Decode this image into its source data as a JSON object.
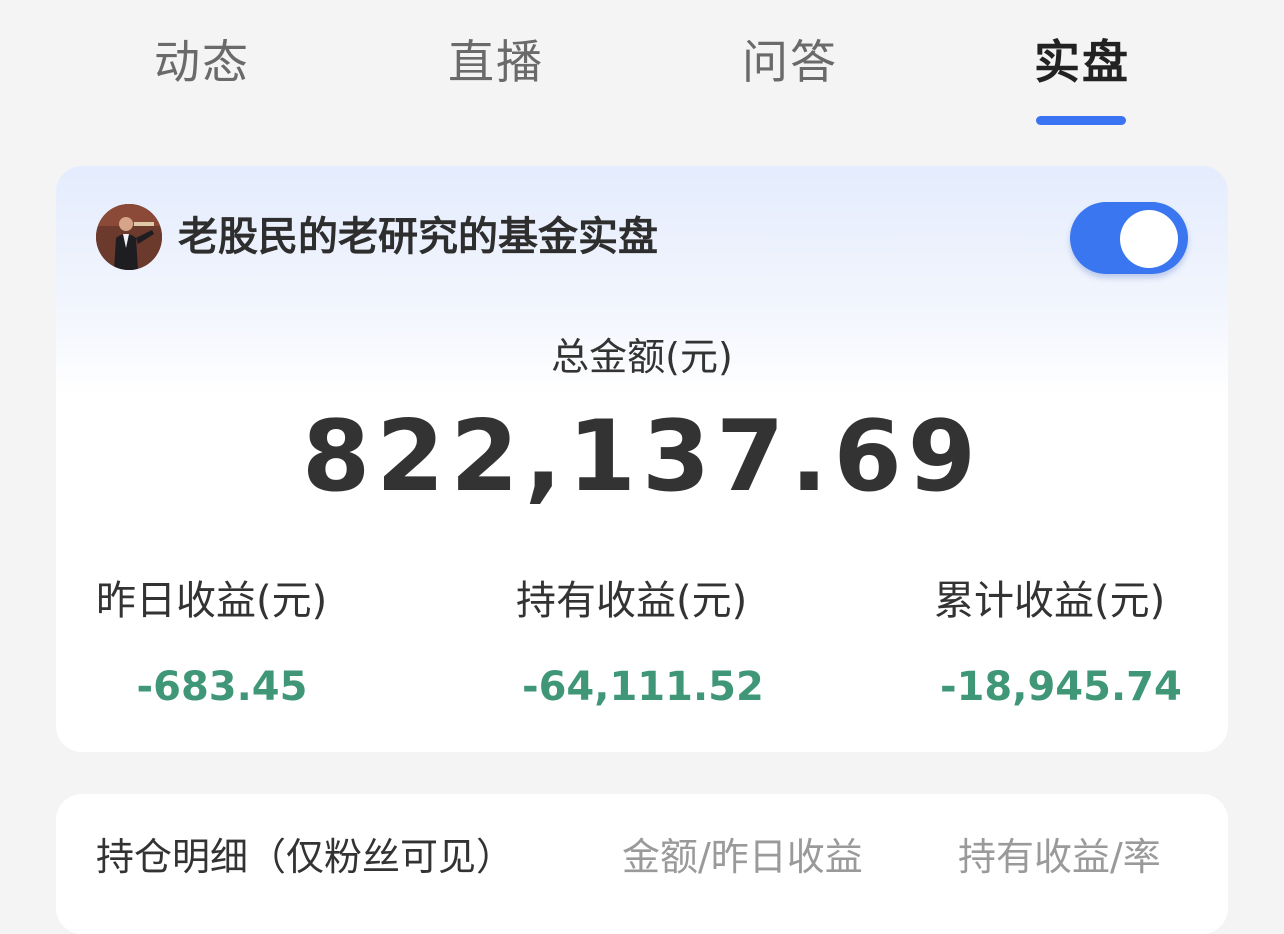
{
  "tabs": [
    {
      "label": "动态",
      "active": false
    },
    {
      "label": "直播",
      "active": false
    },
    {
      "label": "问答",
      "active": false
    },
    {
      "label": "实盘",
      "active": true
    }
  ],
  "accent_color": "#3b74f2",
  "loss_color": "#3f9778",
  "portfolio": {
    "title": "老股民的老研究的基金实盘",
    "toggle_on": true,
    "total_label": "总金额(元)",
    "total_value": "822,137.69",
    "stats": [
      {
        "label": "昨日收益(元)",
        "value": "-683.45"
      },
      {
        "label": "持有收益(元)",
        "value": "-64,111.52"
      },
      {
        "label": "累计收益(元)",
        "value": "-18,945.74"
      }
    ]
  },
  "holdings": {
    "title": "持仓明细（仅粉丝可见）",
    "col_amount": "金额/昨日收益",
    "col_return": "持有收益/率"
  }
}
